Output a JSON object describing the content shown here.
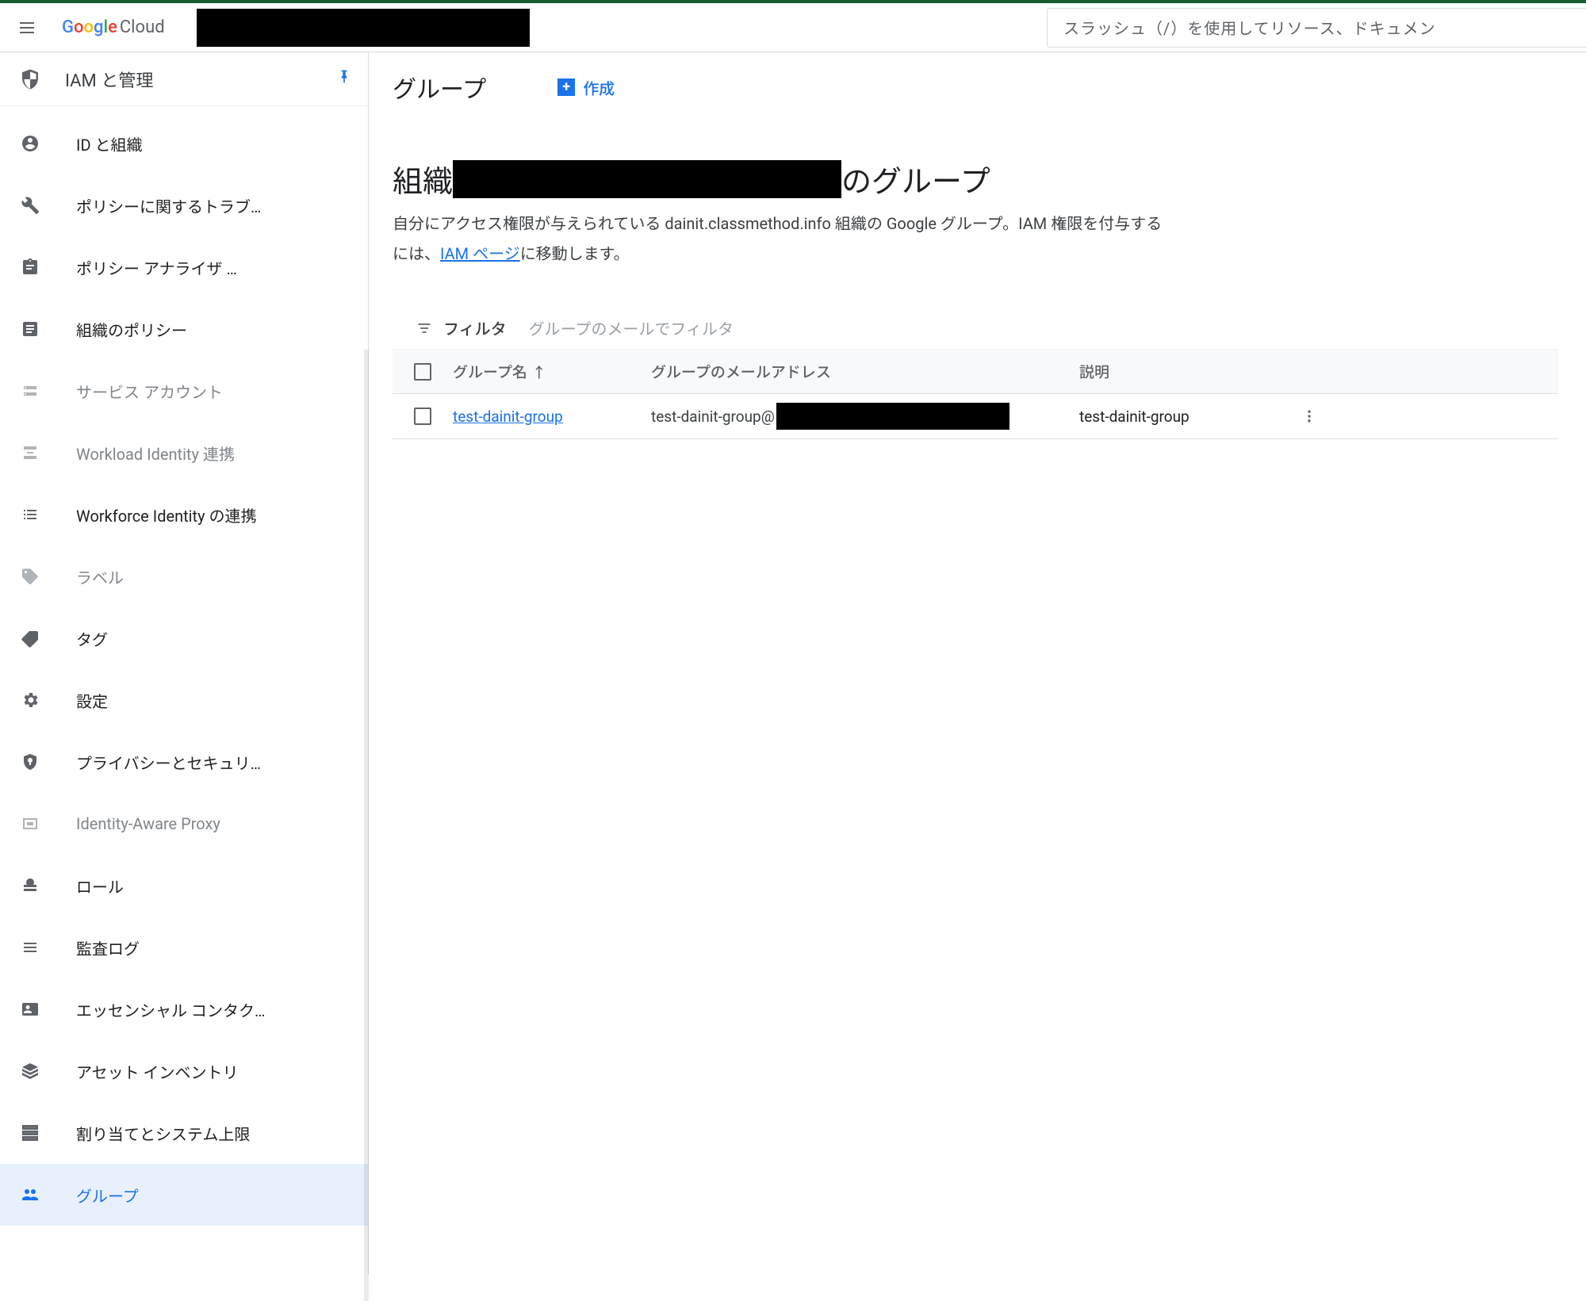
{
  "brand": {
    "name_logo_cloud": "Cloud"
  },
  "search": {
    "placeholder": "スラッシュ（/）を使用してリソース、ドキュメン"
  },
  "sidebar": {
    "title": "IAM と管理",
    "items": [
      {
        "icon": "account",
        "label": "ID と組織",
        "disabled": false
      },
      {
        "icon": "wrench",
        "label": "ポリシーに関するトラブ…",
        "disabled": false
      },
      {
        "icon": "clipboard",
        "label": "ポリシー アナライザ …",
        "disabled": false
      },
      {
        "icon": "doc",
        "label": "組織のポリシー",
        "disabled": false
      },
      {
        "icon": "service",
        "label": "サービス アカウント",
        "disabled": true
      },
      {
        "icon": "wif",
        "label": "Workload Identity 連携",
        "disabled": true
      },
      {
        "icon": "list",
        "label": "Workforce Identity の連携",
        "disabled": false
      },
      {
        "icon": "tag-lite",
        "label": "ラベル",
        "disabled": true
      },
      {
        "icon": "tag",
        "label": "タグ",
        "disabled": false
      },
      {
        "icon": "gear",
        "label": "設定",
        "disabled": false
      },
      {
        "icon": "privacy",
        "label": "プライバシーとセキュリ…",
        "disabled": false
      },
      {
        "icon": "iap",
        "label": "Identity-Aware Proxy",
        "disabled": true
      },
      {
        "icon": "role",
        "label": "ロール",
        "disabled": false
      },
      {
        "icon": "audit",
        "label": "監査ログ",
        "disabled": false
      },
      {
        "icon": "contacts",
        "label": "エッセンシャル コンタク…",
        "disabled": false
      },
      {
        "icon": "assets",
        "label": "アセット インベントリ",
        "disabled": false
      },
      {
        "icon": "quota",
        "label": "割り当てとシステム上限",
        "disabled": false
      },
      {
        "icon": "group",
        "label": "グループ",
        "disabled": false,
        "active": true
      }
    ]
  },
  "main": {
    "page_title": "グループ",
    "create_label": "作成",
    "org_prefix": "組織",
    "org_suffix": "のグループ",
    "desc_1": "自分にアクセス権限が与えられている dainit.classmethod.info 組織の Google グループ。IAM 権限を付与するには、",
    "desc_link": "IAM ページ",
    "desc_2": "に移動します。",
    "filter_label": "フィルタ",
    "filter_placeholder": "グループのメールでフィルタ",
    "columns": {
      "name": "グループ名",
      "email": "グループのメールアドレス",
      "desc": "説明"
    },
    "rows": [
      {
        "name": "test-dainit-group",
        "email_prefix": "test-dainit-group@",
        "desc": "test-dainit-group"
      }
    ]
  }
}
